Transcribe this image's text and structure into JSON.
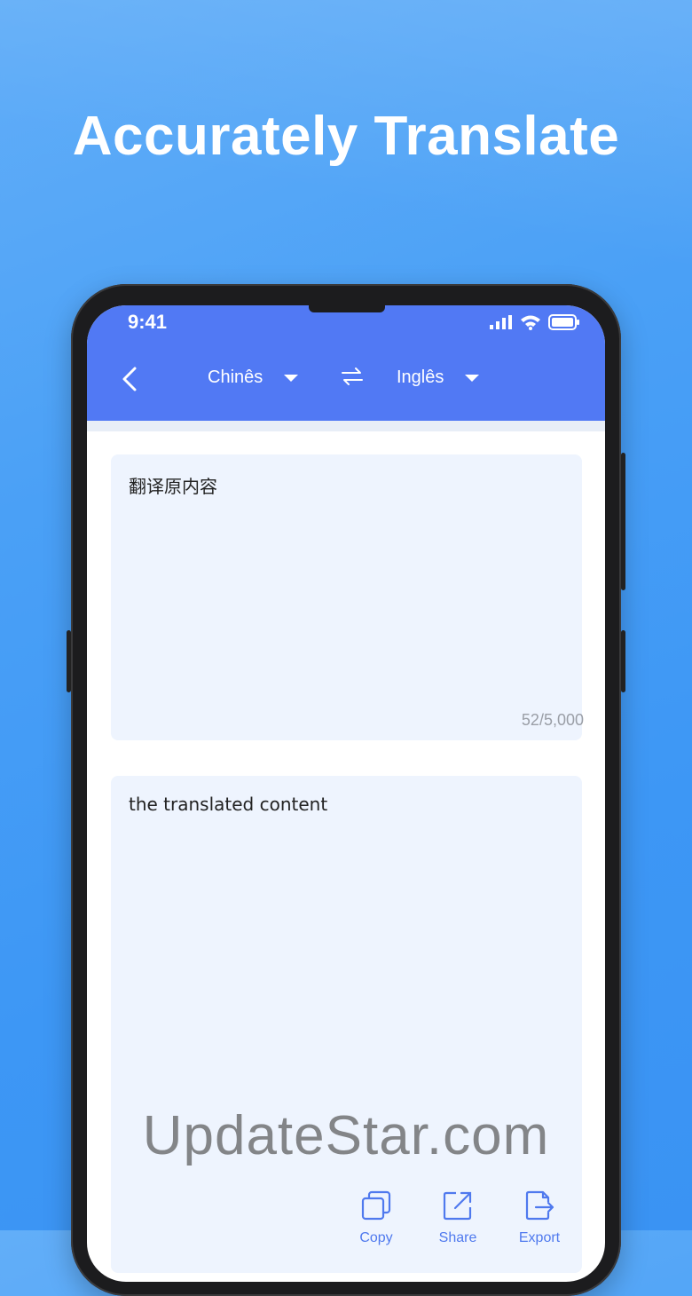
{
  "headline": "Accurately Translate",
  "status_bar": {
    "time": "9:41"
  },
  "app_bar": {
    "source_language": "Chinês",
    "target_language": "Inglês"
  },
  "source_box": {
    "text": "翻译原内容",
    "char_count": "52/5,000"
  },
  "target_box": {
    "text": "the translated content"
  },
  "actions": [
    {
      "label": "Copy",
      "icon": "copy-icon"
    },
    {
      "label": "Share",
      "icon": "share-icon"
    },
    {
      "label": "Export",
      "icon": "export-icon"
    }
  ],
  "watermark": "UpdateStar.com",
  "colors": {
    "accent": "#5179f4",
    "background": "#3d97f5",
    "box": "#eef4fe",
    "action": "#4f79ee"
  }
}
